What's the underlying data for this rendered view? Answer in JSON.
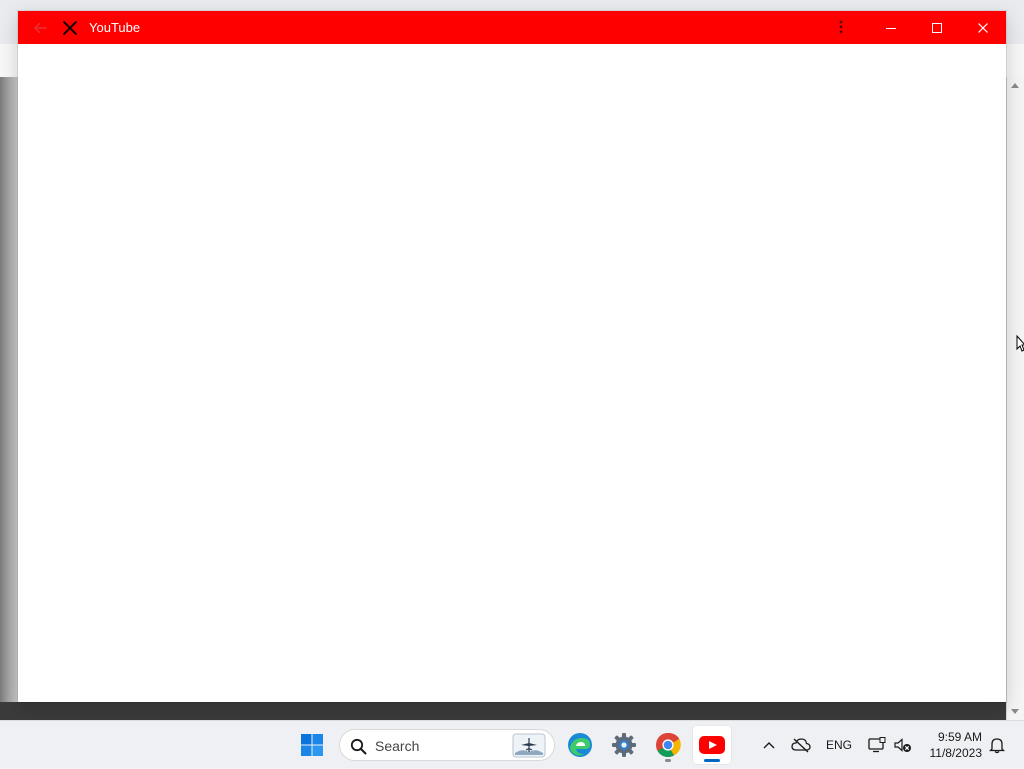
{
  "app_window": {
    "title": "YouTube",
    "icons": {
      "back": "back-arrow-icon",
      "app": "youtube-x-icon",
      "more": "more-vertical-icon",
      "minimize": "minimize-icon",
      "maximize": "maximize-icon",
      "close": "close-icon"
    },
    "colors": {
      "titlebar": "#ff0000",
      "title_text": "#ffffff",
      "content_bg": "#ffffff"
    }
  },
  "taskbar": {
    "search": {
      "placeholder": "Search"
    },
    "pinned_apps": [
      {
        "name": "Start",
        "icon": "windows-start-icon"
      },
      {
        "name": "Microsoft Edge",
        "icon": "edge-icon"
      },
      {
        "name": "Settings",
        "icon": "settings-gear-icon"
      },
      {
        "name": "Google Chrome",
        "icon": "chrome-icon",
        "running": true
      },
      {
        "name": "YouTube",
        "icon": "youtube-icon",
        "active": true
      }
    ],
    "tray": {
      "language": "ENG",
      "time": "9:59 AM",
      "date": "11/8/2023"
    }
  }
}
